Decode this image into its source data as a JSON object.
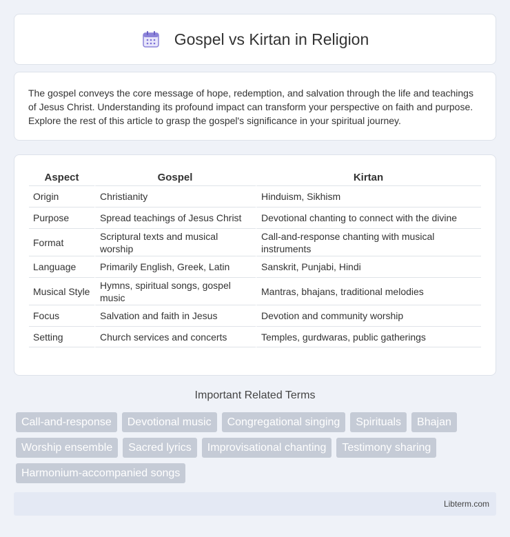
{
  "header": {
    "title": "Gospel vs Kirtan in Religion",
    "icon": "calendar-icon"
  },
  "intro": {
    "text": "The gospel conveys the core message of hope, redemption, and salvation through the life and teachings of Jesus Christ. Understanding its profound impact can transform your perspective on faith and purpose. Explore the rest of this article to grasp the gospel's significance in your spiritual journey."
  },
  "table": {
    "headers": [
      "Aspect",
      "Gospel",
      "Kirtan"
    ],
    "rows": [
      {
        "aspect": "Origin",
        "gospel": "Christianity",
        "kirtan": "Hinduism, Sikhism"
      },
      {
        "aspect": "Purpose",
        "gospel": "Spread teachings of Jesus Christ",
        "kirtan": "Devotional chanting to connect with the divine"
      },
      {
        "aspect": "Format",
        "gospel": "Scriptural texts and musical worship",
        "kirtan": "Call-and-response chanting with musical instruments"
      },
      {
        "aspect": "Language",
        "gospel": "Primarily English, Greek, Latin",
        "kirtan": "Sanskrit, Punjabi, Hindi"
      },
      {
        "aspect": "Musical Style",
        "gospel": "Hymns, spiritual songs, gospel music",
        "kirtan": "Mantras, bhajans, traditional melodies"
      },
      {
        "aspect": "Focus",
        "gospel": "Salvation and faith in Jesus",
        "kirtan": "Devotion and community worship"
      },
      {
        "aspect": "Setting",
        "gospel": "Church services and concerts",
        "kirtan": "Temples, gurdwaras, public gatherings"
      }
    ]
  },
  "related": {
    "title": "Important Related Terms",
    "tags": [
      "Call-and-response",
      "Devotional music",
      "Congregational singing",
      "Spirituals",
      "Bhajan",
      "Worship ensemble",
      "Sacred lyrics",
      "Improvisational chanting",
      "Testimony sharing",
      "Harmonium-accompanied songs"
    ]
  },
  "footer": {
    "site": "Libterm.com"
  },
  "colors": {
    "background": "#eff2f8",
    "tag_background": "#c5cbd6",
    "footer_background": "#e4e9f4",
    "icon_accent": "#7b6fd6"
  }
}
